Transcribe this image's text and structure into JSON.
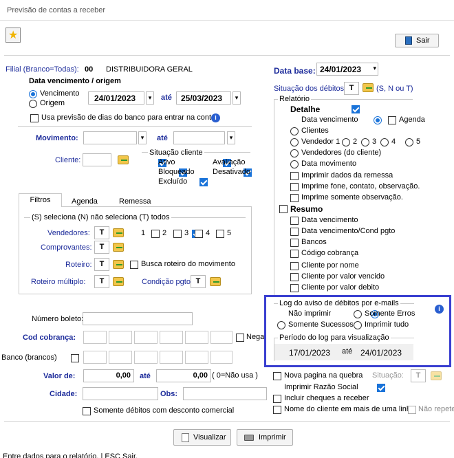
{
  "window": {
    "title": "Previsão de contas a receber"
  },
  "toolbar": {
    "exit_label": "Sair"
  },
  "filial": {
    "label": "Filial (Branco=Todas):",
    "code": "00",
    "name": "DISTRIBUIDORA GERAL"
  },
  "data_venc": {
    "title": "Data vencimento / origem",
    "opt_venc": "Vencimento",
    "opt_origem": "Origem",
    "date_from": "24/01/2023",
    "ate": "até",
    "date_to": "25/03/2023",
    "usa_previsao": "Usa previsão de dias do banco para entrar na conta."
  },
  "movimento": {
    "label": "Movimento:",
    "ate": "até"
  },
  "cliente": {
    "label": "Cliente:"
  },
  "situacao_cliente": {
    "title": "Situação cliente",
    "ativo": "Ativo",
    "avaliacao": "Avaliação",
    "bloqueado": "Bloqueado",
    "desativado": "Desativado",
    "excluido": "Excluído"
  },
  "tabs": {
    "filtros": "Filtros",
    "agenda": "Agenda",
    "remessa": "Remessa"
  },
  "filtros": {
    "legend": "(S) seleciona  (N) não seleciona  (T) todos",
    "vendedores": "Vendedores:",
    "t": "T",
    "v1": "1",
    "v2": "2",
    "v3": "3",
    "v4": "4",
    "v5": "5",
    "comprovantes": "Comprovantes:",
    "roteiro": "Roteiro:",
    "busca_roteiro": "Busca roteiro do movimento",
    "roteiro_multiplo": "Roteiro múltiplo:",
    "condicao_pgto": "Condição pgto:"
  },
  "lower": {
    "numero_boleto": "Número boleto:",
    "cod_cobranca": "Cod cobrança:",
    "nega": "Nega",
    "banco_brancos": "Banco (brancos)",
    "valor_de": "Valor de:",
    "valor_from": "0,00",
    "ate": "até",
    "valor_to": "0,00",
    "nao_usa": "( 0=Não usa )",
    "cidade": "Cidade:",
    "obs": "Obs:",
    "somente_desconto": "Somente débitos com desconto comercial"
  },
  "data_base": {
    "label": "Data base:",
    "value": "24/01/2023"
  },
  "situacao_debitos": {
    "label": "Situação dos débitos:",
    "value": "T",
    "hint": "(S, N ou T)"
  },
  "relatorio": {
    "title": "Relatório",
    "detalhe": "Detalhe",
    "data_vencimento": "Data vencimento",
    "agenda": "Agenda",
    "clientes": "Clientes",
    "vendedor": "Vendedor 1",
    "v2": "2",
    "v3": "3",
    "v4": "4",
    "v5": "5",
    "vendedores_cliente": "Vendedores (do cliente)",
    "data_movimento": "Data movimento",
    "imprimir_remessa": "Imprimir dados da remessa",
    "imprime_fone": "Imprime fone, contato, observação.",
    "imprime_obs": "Imprime somente observação.",
    "resumo": "Resumo",
    "r_data_venc": "Data vencimento",
    "r_data_venc_cond": "Data vencimento/Cond pgto",
    "r_bancos": "Bancos",
    "r_cod_cobranca": "Código cobrança",
    "r_cliente_nome": "Cliente por nome",
    "r_cliente_vencido": "Cliente por valor vencido",
    "r_cliente_debito": "Cliente por valor debito"
  },
  "log": {
    "title": "Log do aviso de débitos por e-mails",
    "nao_imprimir": "Não imprimir",
    "somente_erros": "Somente Erros",
    "somente_sucessos": "Somente Sucessos",
    "imprimir_tudo": "Imprimir tudo",
    "periodo_title": "Período do log para visualização",
    "date_from": "17/01/2023",
    "ate": "até",
    "date_to": "24/01/2023"
  },
  "options": {
    "nova_pagina": "Nova pagina na quebra",
    "situacao": "Situação:",
    "situacao_value": "T",
    "razao_social": "Imprimir Razão Social",
    "incluir_cheques": "Incluir cheques a receber",
    "nome_cliente": "Nome do cliente em mais de uma linha",
    "nao_repete": "Não repete"
  },
  "buttons": {
    "visualizar": "Visualizar",
    "imprimir": "Imprimir"
  },
  "status": {
    "text": "Entre dados para o relatório. | ESC Sair."
  },
  "colors": {
    "accent": "#1b2a9a",
    "highlight_border": "#3a3fd0",
    "check_blue": "#1a73d9"
  }
}
